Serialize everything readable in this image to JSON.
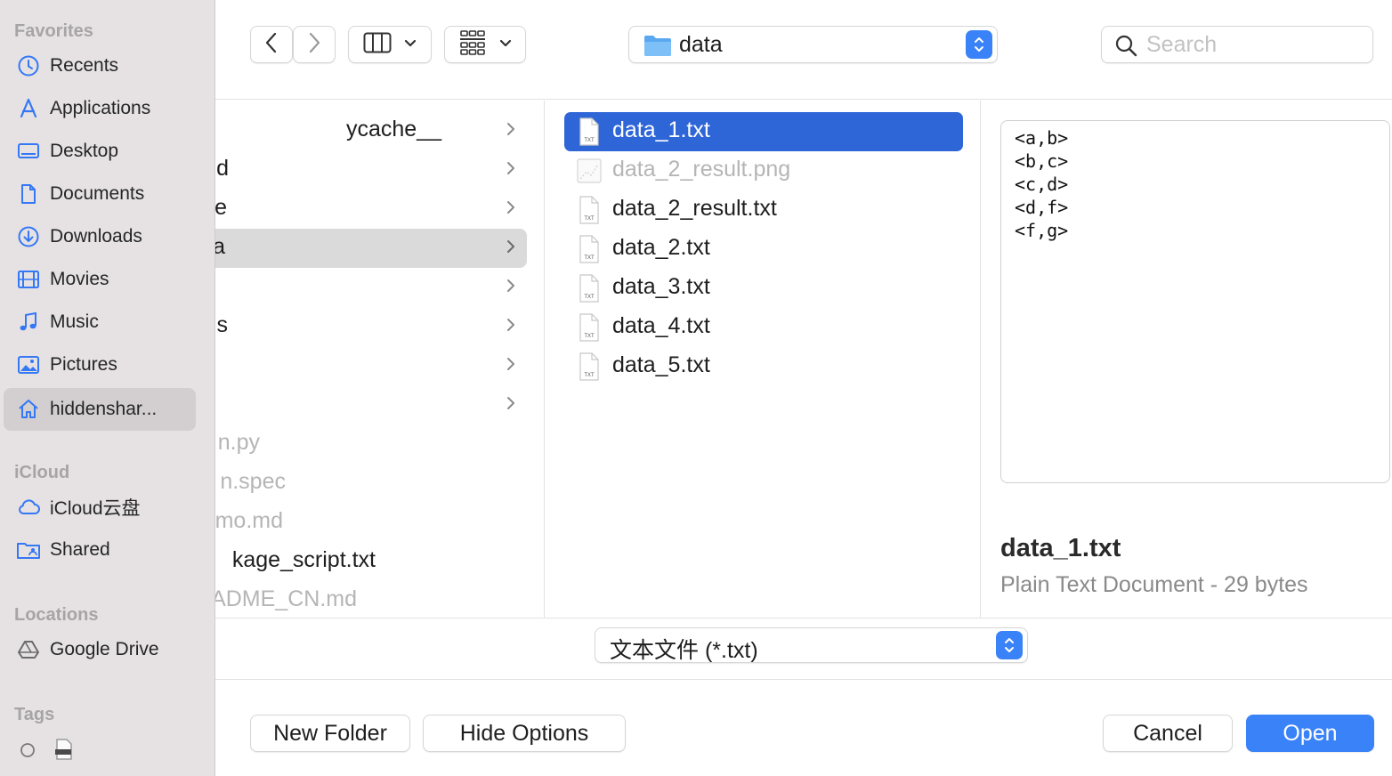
{
  "sidebar": {
    "favorites_title": "Favorites",
    "favorites": [
      {
        "label": "Recents",
        "icon": "clock-icon"
      },
      {
        "label": "Applications",
        "icon": "applications-icon"
      },
      {
        "label": "Desktop",
        "icon": "desktop-icon"
      },
      {
        "label": "Documents",
        "icon": "document-icon"
      },
      {
        "label": "Downloads",
        "icon": "download-icon"
      },
      {
        "label": "Movies",
        "icon": "film-icon"
      },
      {
        "label": "Music",
        "icon": "music-note-icon"
      },
      {
        "label": "Pictures",
        "icon": "photo-icon"
      },
      {
        "label": "hiddenshar...",
        "icon": "home-icon"
      }
    ],
    "icloud_title": "iCloud",
    "icloud": [
      {
        "label": "iCloud云盘",
        "icon": "cloud-icon"
      },
      {
        "label": "Shared",
        "icon": "shared-folder-icon"
      }
    ],
    "locations_title": "Locations",
    "locations": [
      {
        "label": "Google Drive",
        "icon": "drive-icon"
      }
    ],
    "tags_title": "Tags"
  },
  "toolbar": {
    "path_label": "data",
    "search_placeholder": "Search"
  },
  "column1": {
    "items": [
      {
        "name": "ycache__",
        "folder": true,
        "dim": false
      },
      {
        "name": "d",
        "folder": true,
        "dim": false
      },
      {
        "name": "e",
        "folder": true,
        "dim": false
      },
      {
        "name": "a",
        "folder": true,
        "dim": false,
        "selected": true
      },
      {
        "name": "",
        "folder": true,
        "dim": false
      },
      {
        "name": "s",
        "folder": true,
        "dim": false
      },
      {
        "name": "",
        "folder": true,
        "dim": false
      },
      {
        "name": "",
        "folder": true,
        "dim": false
      },
      {
        "name": "n.py",
        "folder": false,
        "dim": true
      },
      {
        "name": "n.spec",
        "folder": false,
        "dim": true
      },
      {
        "name": "mo.md",
        "folder": false,
        "dim": true
      },
      {
        "name": "kage_script.txt",
        "folder": false,
        "dim": false
      },
      {
        "name": "ADME_CN.md",
        "folder": false,
        "dim": true
      }
    ]
  },
  "column2": {
    "files": [
      {
        "name": "data_1.txt",
        "selected": true,
        "dim": false
      },
      {
        "name": "data_2_result.png",
        "selected": false,
        "dim": true
      },
      {
        "name": "data_2_result.txt",
        "selected": false,
        "dim": false
      },
      {
        "name": "data_2.txt",
        "selected": false,
        "dim": false
      },
      {
        "name": "data_3.txt",
        "selected": false,
        "dim": false
      },
      {
        "name": "data_4.txt",
        "selected": false,
        "dim": false
      },
      {
        "name": "data_5.txt",
        "selected": false,
        "dim": false
      }
    ]
  },
  "preview": {
    "lines": [
      "<a,b>",
      "<b,c>",
      "<c,d>",
      "<d,f>",
      "<f,g>"
    ],
    "file_name": "data_1.txt",
    "file_info": "Plain Text Document - 29 bytes"
  },
  "filter": {
    "label": "文本文件 (*.txt)"
  },
  "buttons": {
    "new_folder": "New Folder",
    "hide_options": "Hide Options",
    "cancel": "Cancel",
    "open": "Open"
  },
  "colors": {
    "accent": "#3a82f7",
    "selection": "#2e66d8",
    "sidebar_bg": "#e6e2e3"
  }
}
